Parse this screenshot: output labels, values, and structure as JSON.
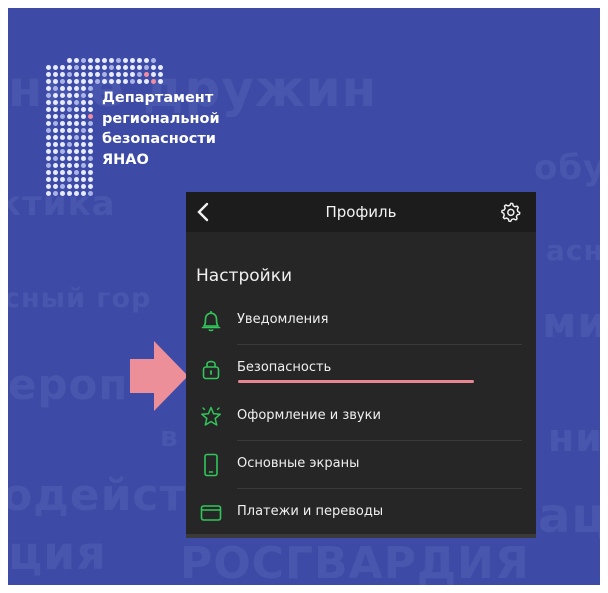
{
  "background_words": [
    "ные дружин",
    "обу",
    "ктика",
    "асн",
    "сный гор",
    "ми",
    "ероп",
    "в",
    "ние",
    "одейст",
    "ац",
    "ция",
    "РОСГВАРДИЯ"
  ],
  "logo": {
    "line1": "Департамент",
    "line2": "региональной",
    "line3": "безопасности",
    "line4": "ЯНАО"
  },
  "header": {
    "title": "Профиль",
    "back_icon": "chevron-left-icon",
    "settings_icon": "gear-icon"
  },
  "settings": {
    "heading": "Настройки",
    "items": [
      {
        "label": "Уведомления",
        "icon": "bell-icon"
      },
      {
        "label": "Безопасность",
        "icon": "lock-icon"
      },
      {
        "label": "Оформление и звуки",
        "icon": "star-icon"
      },
      {
        "label": "Основные экраны",
        "icon": "phone-icon"
      },
      {
        "label": "Платежи и переводы",
        "icon": "wallet-icon"
      }
    ]
  },
  "colors": {
    "poster_bg": "#3d4ba6",
    "app_bg": "#262626",
    "accent_green": "#31c55a",
    "highlight_pink": "#e88791"
  }
}
